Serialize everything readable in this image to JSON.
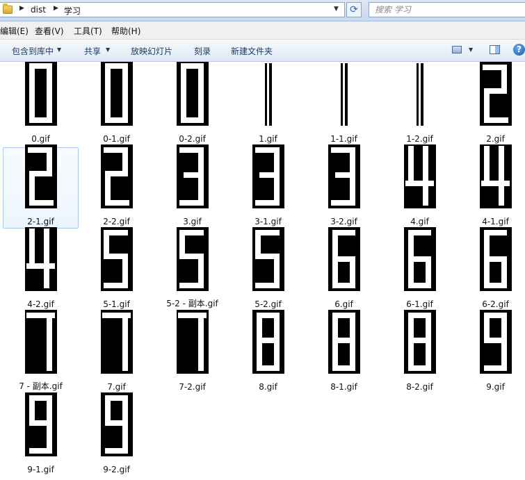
{
  "address_bar": {
    "crumbs": [
      "dist",
      "学习"
    ],
    "search_placeholder": "搜索 学习"
  },
  "menu": {
    "items": [
      "编辑(E)",
      "查看(V)",
      "工具(T)",
      "帮助(H)"
    ]
  },
  "toolbar": {
    "include_library": "包含到库中",
    "share": "共享",
    "slideshow": "放映幻灯片",
    "burn": "刻录",
    "new_folder": "新建文件夹"
  },
  "files": [
    {
      "name": "0.gif",
      "glyph": "0"
    },
    {
      "name": "0-1.gif",
      "glyph": "0"
    },
    {
      "name": "0-2.gif",
      "glyph": "0"
    },
    {
      "name": "1.gif",
      "glyph": "1"
    },
    {
      "name": "1-1.gif",
      "glyph": "1"
    },
    {
      "name": "1-2.gif",
      "glyph": "1"
    },
    {
      "name": "2.gif",
      "glyph": "2"
    },
    {
      "name": "2-1.gif",
      "glyph": "2",
      "selected": true
    },
    {
      "name": "2-2.gif",
      "glyph": "2"
    },
    {
      "name": "3.gif",
      "glyph": "3"
    },
    {
      "name": "3-1.gif",
      "glyph": "3"
    },
    {
      "name": "3-2.gif",
      "glyph": "3"
    },
    {
      "name": "4.gif",
      "glyph": "4"
    },
    {
      "name": "4-1.gif",
      "glyph": "4"
    },
    {
      "name": "4-2.gif",
      "glyph": "4"
    },
    {
      "name": "5-1.gif",
      "glyph": "5"
    },
    {
      "name": "5-2 - 副本.gif",
      "glyph": "5"
    },
    {
      "name": "5-2.gif",
      "glyph": "5"
    },
    {
      "name": "6.gif",
      "glyph": "6"
    },
    {
      "name": "6-1.gif",
      "glyph": "6"
    },
    {
      "name": "6-2.gif",
      "glyph": "6"
    },
    {
      "name": "7 - 副本.gif",
      "glyph": "7"
    },
    {
      "name": "7.gif",
      "glyph": "7"
    },
    {
      "name": "7-2.gif",
      "glyph": "7"
    },
    {
      "name": "8.gif",
      "glyph": "8"
    },
    {
      "name": "8-1.gif",
      "glyph": "8"
    },
    {
      "name": "8-2.gif",
      "glyph": "8"
    },
    {
      "name": "9.gif",
      "glyph": "9"
    },
    {
      "name": "9-1.gif",
      "glyph": "9"
    },
    {
      "name": "9-2.gif",
      "glyph": "9"
    }
  ]
}
